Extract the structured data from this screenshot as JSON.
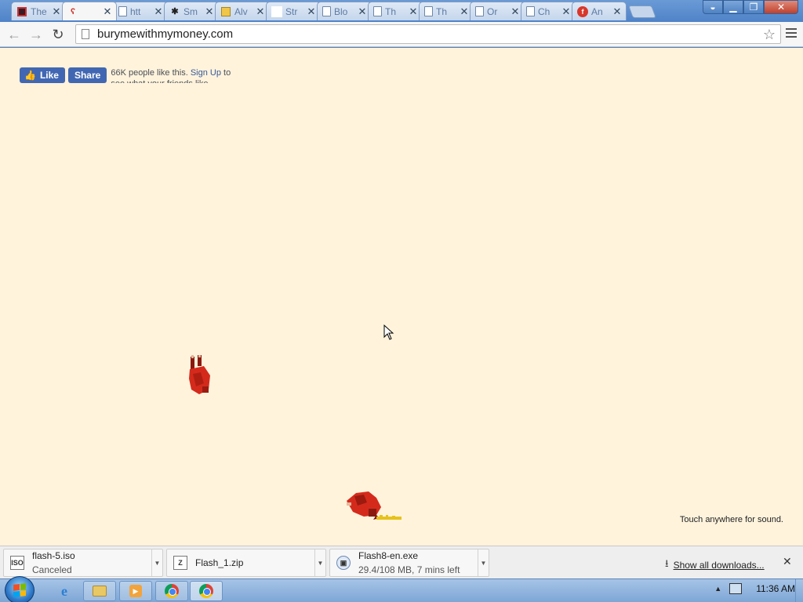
{
  "browser": {
    "tabs": [
      {
        "title": "The",
        "favicon": "square-red-icon",
        "active": false
      },
      {
        "title": "",
        "favicon": "ribbon-icon",
        "active": true
      },
      {
        "title": "htt",
        "favicon": "page-icon",
        "active": false
      },
      {
        "title": "Sm",
        "favicon": "octopus-icon",
        "active": false
      },
      {
        "title": "Alv",
        "favicon": "yellow-box-icon",
        "active": false
      },
      {
        "title": "Str",
        "favicon": "blank-icon",
        "active": false
      },
      {
        "title": "Blo",
        "favicon": "page-icon",
        "active": false
      },
      {
        "title": "Th",
        "favicon": "page-icon",
        "active": false
      },
      {
        "title": "Th",
        "favicon": "page-icon",
        "active": false
      },
      {
        "title": "Or",
        "favicon": "page-icon",
        "active": false
      },
      {
        "title": "Ch",
        "favicon": "page-icon",
        "active": false
      },
      {
        "title": "An",
        "favicon": "flash-icon",
        "active": false
      }
    ],
    "url": "burymewithmymoney.com"
  },
  "page": {
    "facebook": {
      "like_label": "Like",
      "share_label": "Share",
      "text_count": "66K people like this.",
      "text_signup": "Sign Up",
      "text_rest": "to see what your friends like."
    },
    "sound_hint": "Touch anywhere for sound."
  },
  "downloads": {
    "items": [
      {
        "name": "flash-5.iso",
        "status": "Canceled",
        "icon": "iso-file-icon"
      },
      {
        "name": "Flash_1.zip",
        "status": "",
        "icon": "zip-file-icon"
      },
      {
        "name": "Flash8-en.exe",
        "status": "29.4/108 MB, 7 mins left",
        "icon": "exe-file-icon"
      }
    ],
    "show_all_label": "Show all downloads..."
  },
  "taskbar": {
    "clock": "11:36 AM"
  },
  "colors": {
    "page_background": "#fff3dc",
    "facebook_blue": "#4267b2",
    "character_red": "#d42a1c"
  }
}
